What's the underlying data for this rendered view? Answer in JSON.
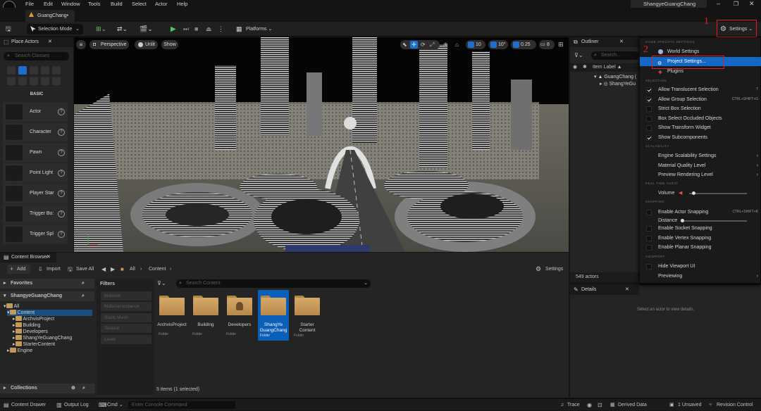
{
  "menubar": {
    "items": [
      "File",
      "Edit",
      "Window",
      "Tools",
      "Build",
      "Select",
      "Actor",
      "Help"
    ],
    "project_name": "ShangyeGuangChang"
  },
  "tab": {
    "label": "GuangChang•"
  },
  "toolbar": {
    "selection_mode": "Selection Mode",
    "platforms": "Platforms",
    "settings": "Settings"
  },
  "annotations": {
    "first": "1",
    "second": "2"
  },
  "place_actors": {
    "title": "Place Actors",
    "search_placeholder": "Search Classes",
    "category": "BASIC",
    "items": [
      "Actor",
      "Character",
      "Pawn",
      "Point Light",
      "Player Star",
      "Trigger Bo:",
      "Trigger Spl"
    ]
  },
  "viewport": {
    "perspective": "Perspective",
    "unlit": "Unlit",
    "show": "Show",
    "grid_snap": "10",
    "rot_snap": "10°",
    "scale_snap": "0.25",
    "cam_speed": "8"
  },
  "outliner": {
    "title": "Outliner",
    "search_placeholder": "Search...",
    "column": "Item Label ▲",
    "rows": [
      "GuangChang (",
      "ShangYeGu"
    ],
    "count": "549 actors"
  },
  "details": {
    "title": "Details",
    "empty": "Select an actor to view details."
  },
  "settings_menu": {
    "sections": {
      "game": "GAME SPECIFIC SETTINGS",
      "selection": "SELECTION",
      "scalability": "SCALABILITY",
      "audio": "REAL TIME AUDIO",
      "snapping": "SNAPPING",
      "viewport": "VIEWPORT"
    },
    "world_settings": "World Settings",
    "project_settings": "Project Settings...",
    "plugins": "Plugins",
    "allow_translucent": "Allow Translucent Selection",
    "allow_translucent_sc": "T",
    "allow_group": "Allow Group Selection",
    "allow_group_sc": "CTRL+SHIFT+G",
    "strict_box": "Strict Box Selection",
    "box_occluded": "Box Select Occluded Objects",
    "show_transform": "Show Transform Widget",
    "show_subcomponents": "Show Subcomponents",
    "engine_scalability": "Engine Scalability Settings",
    "material_quality": "Material Quality Level",
    "preview_rendering": "Preview Rendering Level",
    "volume": "Volume",
    "volume_level": 0.05,
    "enable_actor_snapping": "Enable Actor Snapping",
    "enable_actor_snapping_sc": "CTRL+SHIFT+K",
    "distance": "Distance",
    "distance_level": 0.0,
    "enable_socket": "Enable Socket Snapping",
    "enable_vertex": "Enable Vertex Snapping",
    "enable_planar": "Enable Planar Snapping",
    "hide_viewport_ui": "Hide Viewport UI",
    "previewing": "Previewing"
  },
  "content_browser": {
    "title": "Content Browser",
    "add": "Add",
    "import": "Import",
    "save_all": "Save All",
    "path": [
      "All",
      "Content"
    ],
    "settings": "Settings",
    "favorites": "Favorites",
    "project_root": "ShangyeGuangChang",
    "tree": [
      "All",
      "Content",
      "ArchvisProject",
      "Building",
      "Developers",
      "ShangYeGuangChang",
      "StarterContent",
      "Engine"
    ],
    "collections": "Collections",
    "filters_title": "Filters",
    "filters": [
      "Material",
      "Material Instance",
      "Static Mesh",
      "Texture",
      "Level"
    ],
    "search_placeholder": "Search Content",
    "folders": [
      {
        "name": "ArchvisProject",
        "type": "Folder"
      },
      {
        "name": "Building",
        "type": "Folder"
      },
      {
        "name": "Developers",
        "type": "Folder"
      },
      {
        "name": "ShangYe GuangChang",
        "type": "Folder"
      },
      {
        "name": "Starter Content",
        "type": "Folder"
      }
    ],
    "status": "5 items (1 selected)"
  },
  "statusbar": {
    "content_drawer": "Content Drawer",
    "output_log": "Output Log",
    "cmd": "Cmd",
    "console_placeholder": "Enter Console Command",
    "trace": "Trace",
    "derived_data": "Derived Data",
    "unsaved": "1 Unsaved",
    "revision": "Revision Control"
  },
  "colors": {
    "accent": "#0070e0",
    "annotation": "#e02020",
    "folder": "#c8995a"
  }
}
